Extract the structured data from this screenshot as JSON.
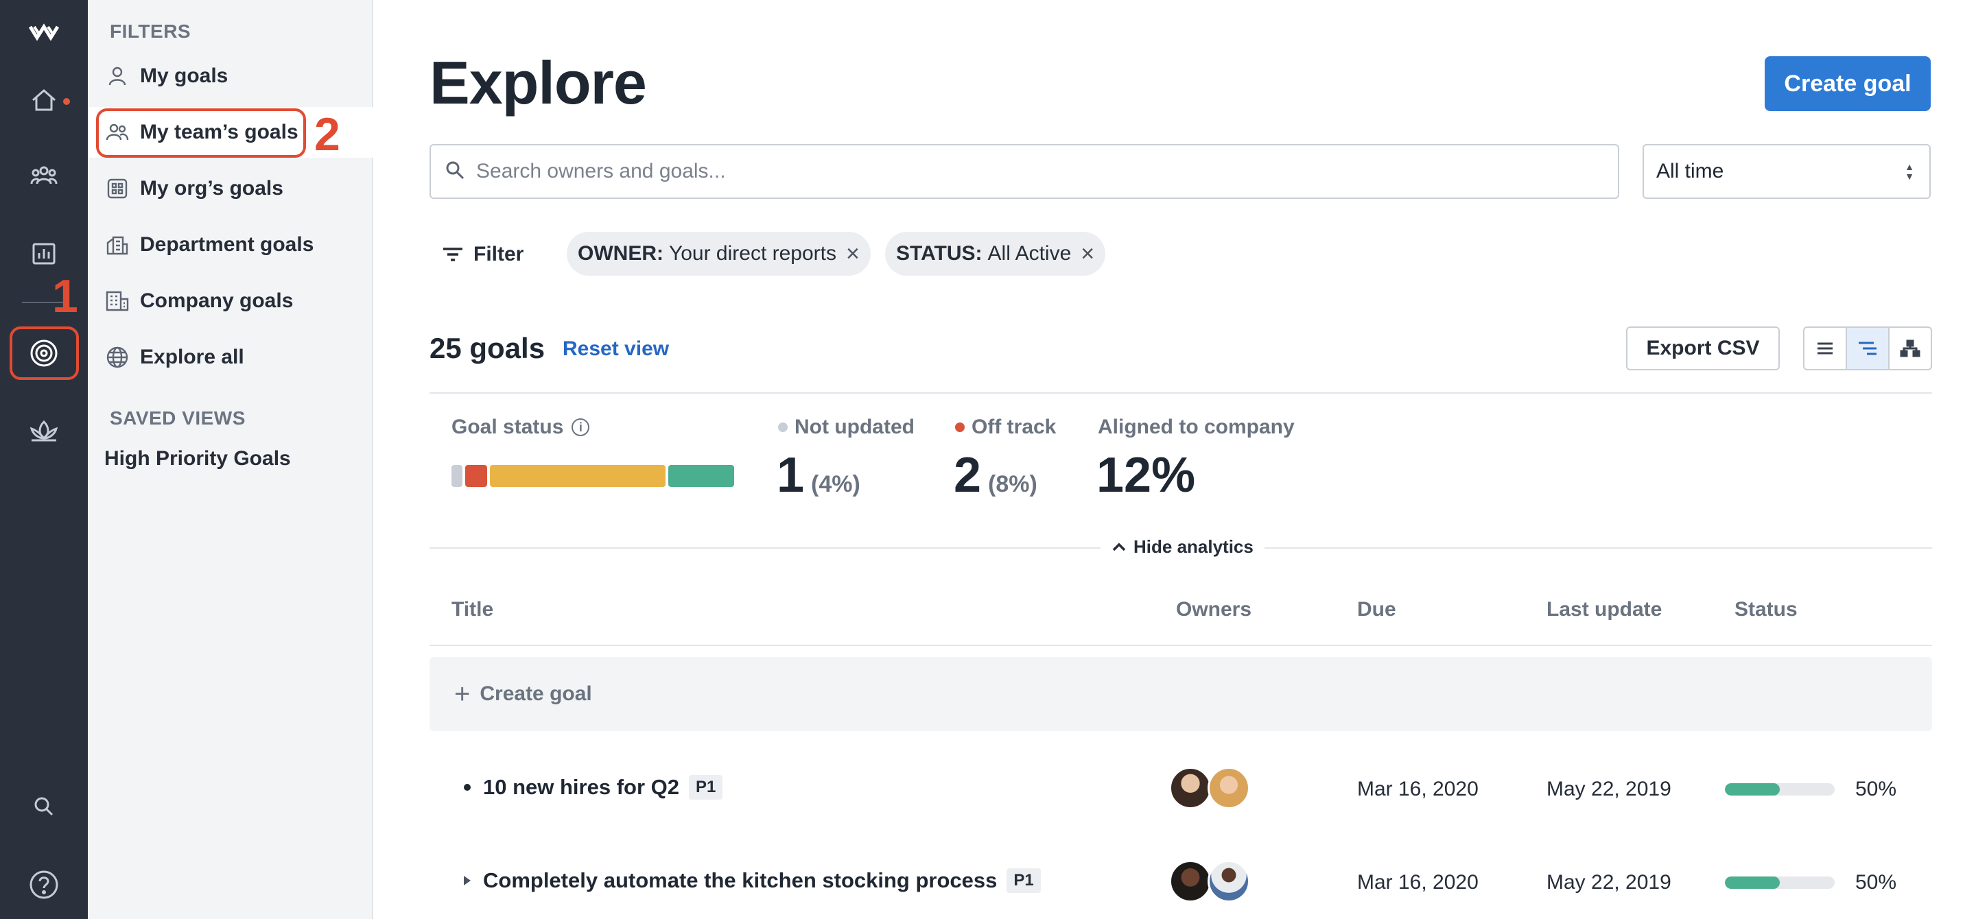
{
  "annotations": {
    "step1": "1",
    "step2": "2"
  },
  "filters": {
    "section_label": "FILTERS",
    "items": [
      {
        "label": "My goals",
        "icon": "person-icon"
      },
      {
        "label": "My team’s goals",
        "icon": "team-icon"
      },
      {
        "label": "My org’s goals",
        "icon": "org-icon"
      },
      {
        "label": "Department goals",
        "icon": "department-icon"
      },
      {
        "label": "Company goals",
        "icon": "company-icon"
      },
      {
        "label": "Explore all",
        "icon": "globe-icon"
      }
    ],
    "saved_label": "SAVED VIEWS",
    "saved_views": [
      "High Priority Goals"
    ]
  },
  "header": {
    "title": "Explore",
    "create_button": "Create goal"
  },
  "search": {
    "placeholder": "Search owners and goals..."
  },
  "time_select": {
    "value": "All time"
  },
  "filter_bar": {
    "filter_label": "Filter",
    "chips": [
      {
        "key": "OWNER:",
        "value": "Your direct reports"
      },
      {
        "key": "STATUS:",
        "value": "All Active"
      }
    ]
  },
  "summary": {
    "count": "25 goals",
    "reset": "Reset view",
    "export": "Export CSV"
  },
  "analytics": {
    "goal_status_label": "Goal status",
    "info_glyph": "i",
    "not_updated_label": "Not updated",
    "not_updated_value": "1",
    "not_updated_pct": "(4%)",
    "off_track_label": "Off track",
    "off_track_value": "2",
    "off_track_pct": "(8%)",
    "aligned_label": "Aligned to company",
    "aligned_value": "12%",
    "hide_label": "Hide analytics",
    "status_segments": [
      {
        "status": "not-updated",
        "share": 0.04,
        "color": "#c9ced6"
      },
      {
        "status": "off-track",
        "share": 0.08,
        "color": "#d9533b"
      },
      {
        "status": "at-risk",
        "share": 0.64,
        "color": "#e9b445"
      },
      {
        "status": "on-track",
        "share": 0.24,
        "color": "#4aaf8f"
      }
    ]
  },
  "table": {
    "headers": [
      "Title",
      "Owners",
      "Due",
      "Last update",
      "Status"
    ],
    "create_label": "Create goal",
    "create_plus": "+",
    "rows": [
      {
        "title": "10 new hires for Q2",
        "priority": "P1",
        "due": "Mar 16, 2020",
        "last_update": "May 22, 2019",
        "progress": 0.5,
        "progress_label": "50%",
        "expandable": false
      },
      {
        "title": "Completely automate the kitchen stocking process",
        "priority": "P1",
        "due": "Mar 16, 2020",
        "last_update": "May 22, 2019",
        "progress": 0.5,
        "progress_label": "50%",
        "expandable": true
      }
    ]
  },
  "colors": {
    "primary": "#2e7bd6",
    "link": "#2567c3",
    "annotation": "#e14b32",
    "rail_bg": "#2a313c",
    "progress": "#4aaf8f"
  }
}
